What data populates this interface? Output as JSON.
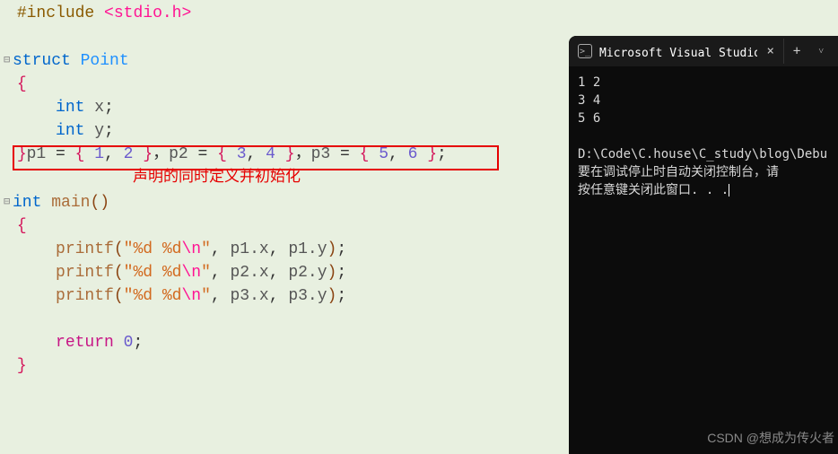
{
  "code": {
    "include_kw": "#include",
    "include_header": "stdio.h",
    "lt": "<",
    "gt": ">",
    "struct_kw": "struct",
    "struct_name": "Point",
    "lbrace": "{",
    "rbrace": "}",
    "int_kw": "int",
    "field_x": "x",
    "field_y": "y",
    "semi": ";",
    "decl_p1": "p1",
    "decl_p2": "p2",
    "decl_p3": "p3",
    "eq": " = ",
    "lbr": "{ ",
    "rbr": " }",
    "n1": "1",
    "n2": "2",
    "n3": "3",
    "n4": "4",
    "n5": "5",
    "n6": "6",
    "comma": ", ",
    "cn_comma": "，",
    "annotation": "声明的同时定义并初始化",
    "main_name": "main",
    "lparen": "(",
    "rparen": ")",
    "printf_name": "printf",
    "fmt_open": "\"%d %d",
    "fmt_esc": "\\n",
    "fmt_close": "\"",
    "p1x": "p1.x",
    "p1y": "p1.y",
    "p2x": "p2.x",
    "p2y": "p2.y",
    "p3x": "p3.x",
    "p3y": "p3.y",
    "return_kw": "return",
    "zero": "0"
  },
  "console": {
    "title": "Microsoft Visual Studio 调试",
    "out1": "1 2",
    "out2": "3 4",
    "out3": "5 6",
    "path": "D:\\Code\\C.house\\C_study\\blog\\Debu",
    "msg1": "要在调试停止时自动关闭控制台，请",
    "msg2": "按任意键关闭此窗口. . ."
  },
  "watermark": "CSDN @想成为传火者"
}
